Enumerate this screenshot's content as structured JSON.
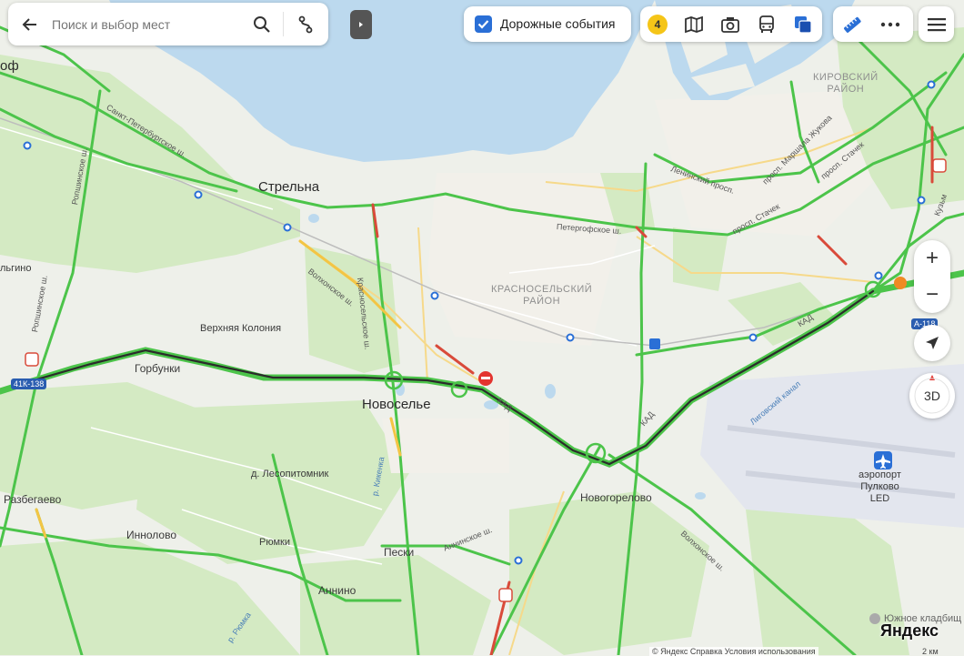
{
  "search": {
    "placeholder": "Поиск и выбор мест"
  },
  "toolbar": {
    "traffic_label": "Дорожные события",
    "traffic_score": "4"
  },
  "controls": {
    "zoom_in": "+",
    "zoom_out": "−",
    "three_d": "3D"
  },
  "places": {
    "strelna": "Стрельна",
    "novoselye": "Новоселье",
    "gorbunki": "Горбунки",
    "verkhnyaya_koloniya": "Верхняя Колония",
    "lesopitomnik": "д. Лесопитомник",
    "razbegaevo": "Разбегаево",
    "innolovo": "Иннолово",
    "ryumki": "Рюмки",
    "annino": "Аннино",
    "peski": "Пески",
    "novogorelovo": "Новогорелово",
    "olgino": "льгино",
    "edge_left": "оф",
    "airport": "аэропорт\nПулково\nLED",
    "cemetery": "Южное кладбищ"
  },
  "districts": {
    "krasnoselsky": "КРАСНОСЕЛЬСКИЙ\nРАЙОН",
    "kirovsky": "КИРОВСКИЙ\nРАЙОН"
  },
  "streets": {
    "spb_sh": "Санкт-Петербургское ш.",
    "ropshinskoe": "Ропшинское ш.",
    "volkhonskoe": "Волхонское ш.",
    "krasnoselskoe": "Красносельское ш.",
    "petergofskoe": "Петергофское ш.",
    "leninsky": "Ленинский просп.",
    "stachek": "просп. Стачек",
    "zhukova": "просп. Маршала Жукова",
    "kad1": "КАД",
    "kad2": "КАД",
    "kad3": "КАД",
    "anninskoe": "Аннинское ш.",
    "volkhonskoe2": "Волхонское ш.",
    "kikenka": "р. Кикенка",
    "ligovsky": "Лиговский канал",
    "ryumka": "р. Рюмка",
    "kuzminskoe": "Кузьм"
  },
  "badges": {
    "road_41k138": "41К-138",
    "road_a118": "А-118"
  },
  "branding": {
    "logo": "Яндекс",
    "copyright": "© Яндекс  Справка  Условия использования",
    "scale": "2 км"
  }
}
